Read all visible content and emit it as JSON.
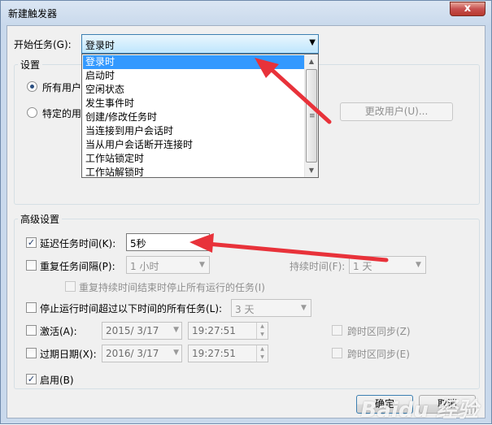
{
  "window": {
    "title": "新建触发器",
    "close_glyph": "x"
  },
  "begin_task": {
    "label": "开始任务(G):",
    "selected": "登录时",
    "options": [
      "登录时",
      "启动时",
      "空闲状态",
      "发生事件时",
      "创建/修改任务时",
      "当连接到用户会话时",
      "当从用户会话断开连接时",
      "工作站锁定时",
      "工作站解锁时"
    ],
    "selected_index": 0
  },
  "settings": {
    "title": "设置",
    "any_user_label": "所有用户",
    "specific_user_label": "特定的用",
    "change_user_button": "更改用户(U)..."
  },
  "advanced": {
    "title": "高级设置",
    "delay": {
      "label": "延迟任务时间(K):",
      "checked": true,
      "value": "5秒"
    },
    "repeat": {
      "label": "重复任务间隔(P):",
      "checked": false,
      "value": "1 小时",
      "duration_label": "持续时间(F):",
      "duration_value": "1 天"
    },
    "stop_all": {
      "label": "重复持续时间结束时停止所有运行的任务(I)",
      "checked": false
    },
    "stop_longer": {
      "label": "停止运行时间超过以下时间的所有任务(L):",
      "checked": false,
      "value": "3 天"
    },
    "activate": {
      "label": "激活(A):",
      "checked": false,
      "date": "2015/ 3/17",
      "time": "19:27:51",
      "sync_label": "跨时区同步(Z)"
    },
    "expire": {
      "label": "过期日期(X):",
      "checked": false,
      "date": "2016/ 3/17",
      "time": "19:27:51",
      "sync_label": "跨时区同步(E)"
    },
    "enabled": {
      "label": "启用(B)",
      "checked": true
    }
  },
  "buttons": {
    "ok": "确定",
    "cancel": "取消"
  },
  "watermark": "Baidu 经验",
  "colors": {
    "annotation": "#e8323a",
    "selection": "#3399ff"
  },
  "check_glyph": "✓"
}
